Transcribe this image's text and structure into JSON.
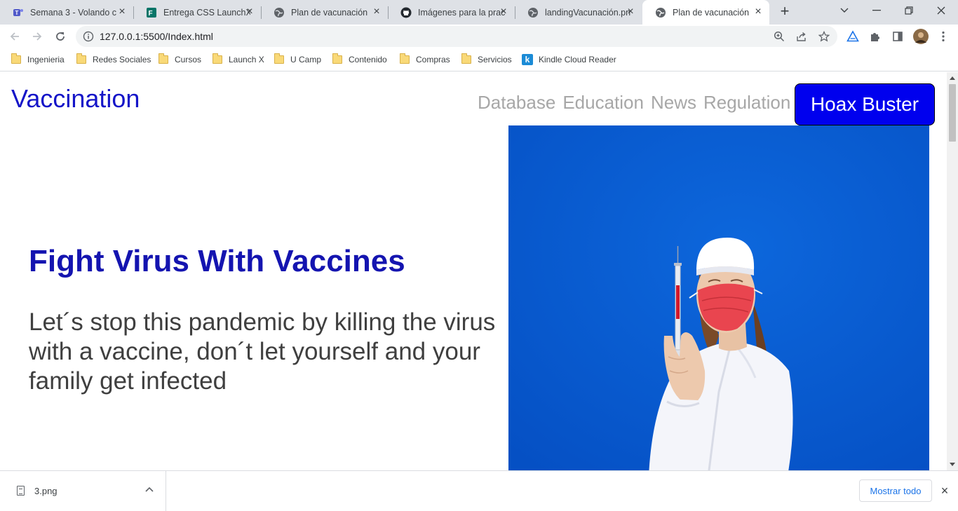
{
  "tabs": [
    {
      "label": "Semana 3 - Volando c",
      "icon": "teams-icon"
    },
    {
      "label": "Entrega CSS LaunchX",
      "icon": "forms-icon"
    },
    {
      "label": "Plan de vacunación",
      "icon": "globe-icon"
    },
    {
      "label": "Imágenes para la prac",
      "icon": "github-icon"
    },
    {
      "label": "landingVacunación.pn",
      "icon": "globe-icon"
    },
    {
      "label": "Plan de vacunación",
      "icon": "globe-icon",
      "active": true
    }
  ],
  "address_bar": {
    "url": "127.0.0.1:5500/Index.html"
  },
  "bookmarks": [
    {
      "label": "Ingenieria"
    },
    {
      "label": "Redes Sociales"
    },
    {
      "label": "Cursos"
    },
    {
      "label": "Launch X"
    },
    {
      "label": "U Camp"
    },
    {
      "label": "Contenido"
    },
    {
      "label": "Compras"
    },
    {
      "label": "Servicios"
    },
    {
      "label": "Kindle Cloud Reader",
      "icon": "kindle-icon"
    }
  ],
  "page": {
    "logo": "Vaccination",
    "nav": [
      "Database",
      "Education",
      "News",
      "Regulation"
    ],
    "cta": "Hoax Buster",
    "hero_title": "Fight Virus With Vaccines",
    "hero_text": "Let´s stop this pandemic by killing the virus with a vaccine, don´t let yourself and your family get infected"
  },
  "downloads": {
    "file_name": "3.png",
    "show_all": "Mostrar todo"
  },
  "colors": {
    "brand": "#1414c8",
    "cta_bg": "#0000ee",
    "hero_bg": "#0a5fd4"
  }
}
